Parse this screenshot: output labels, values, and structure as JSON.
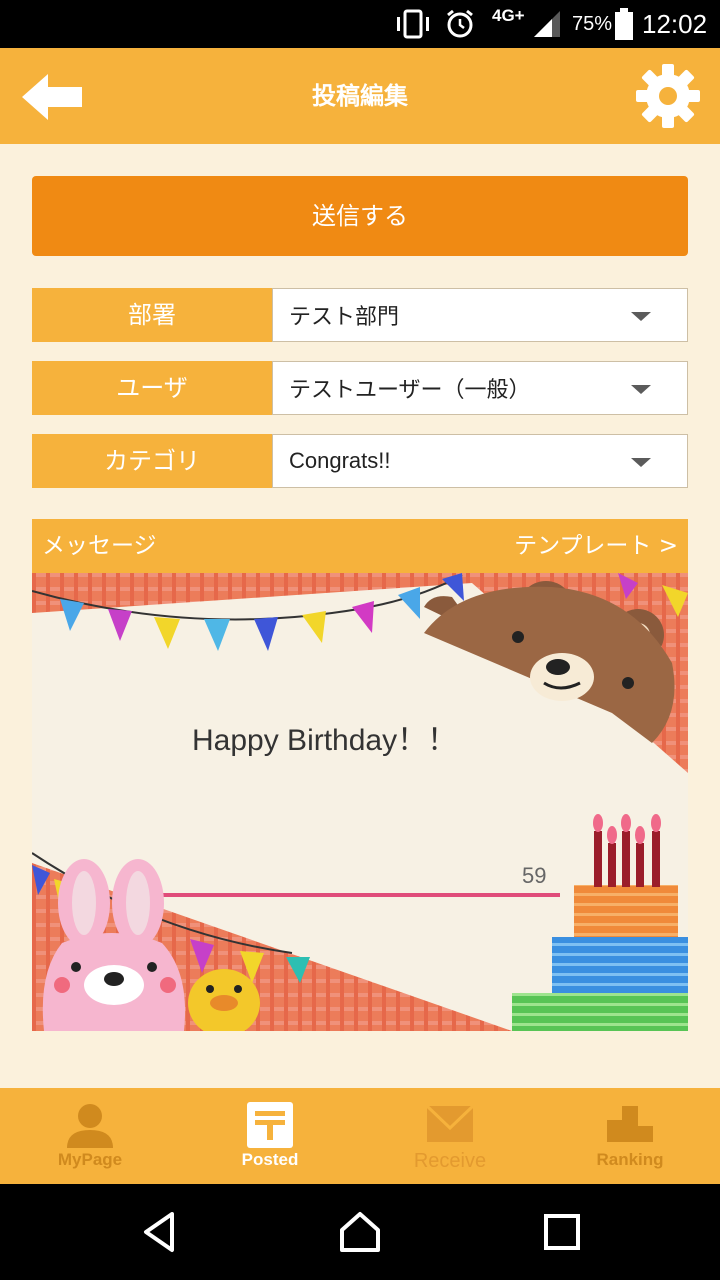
{
  "status_bar": {
    "network": "4G+",
    "battery": "75%",
    "time": "12:02",
    "icons": [
      "vibrate-icon",
      "alarm-icon",
      "signal-icon",
      "battery-icon"
    ]
  },
  "header": {
    "title": "投稿編集",
    "back_icon": "back-arrow-icon",
    "settings_icon": "gear-icon"
  },
  "send_button": "送信する",
  "form": {
    "department": {
      "label": "部署",
      "value": "テスト部門"
    },
    "user": {
      "label": "ユーザ",
      "value": "テストユーザー（一般）"
    },
    "category": {
      "label": "カテゴリ",
      "value": "Congrats!!"
    }
  },
  "message": {
    "label": "メッセージ",
    "template_link": "テンプレート >",
    "text": "Happy Birthday！！",
    "char_count": "59"
  },
  "bottom_nav": [
    {
      "label": "MyPage",
      "icon": "person-icon",
      "active": false
    },
    {
      "label": "Posted",
      "icon": "post-icon",
      "active": true
    },
    {
      "label": "Receive",
      "icon": "envelope-icon",
      "active": false
    },
    {
      "label": "Ranking",
      "icon": "podium-icon",
      "active": false
    }
  ],
  "colors": {
    "header": "#f6b23c",
    "send_button": "#f08a13",
    "background": "#fbf1dc"
  }
}
